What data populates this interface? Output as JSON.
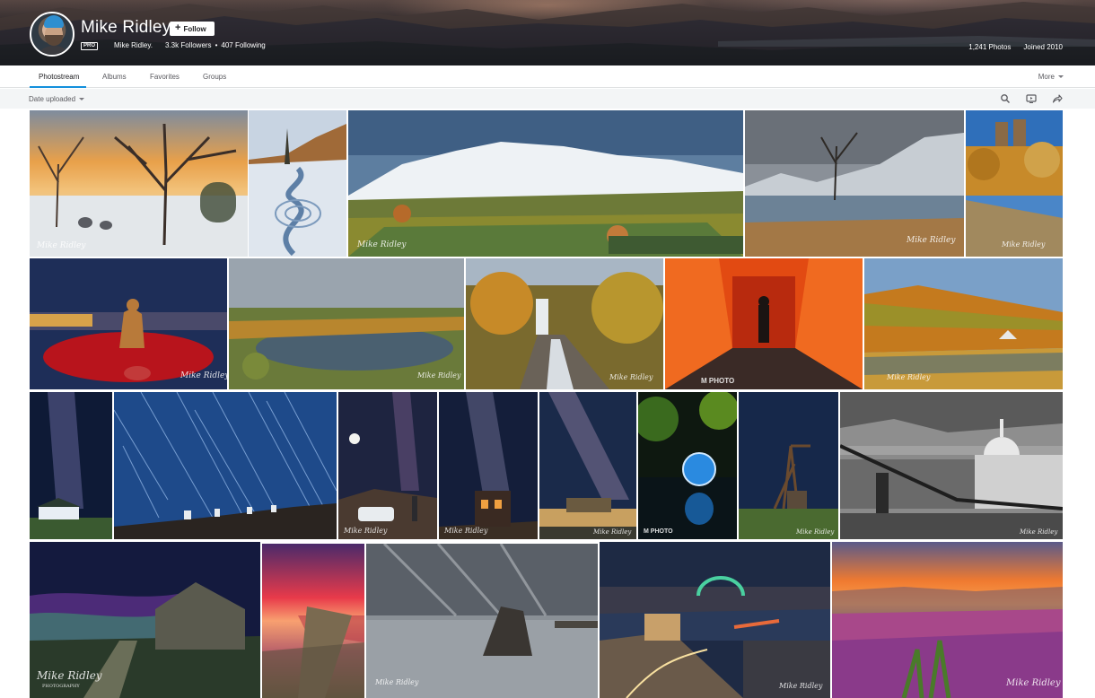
{
  "profile": {
    "name": "Mike Ridley",
    "follow_label": "Follow",
    "pro_label": "PRO",
    "display_name": "Mike Ridley.",
    "followers": "3.3k Followers",
    "following": "407 Following",
    "photos_count": "1,241 Photos",
    "joined": "Joined 2010"
  },
  "tabs": [
    {
      "label": "Photostream",
      "active": true
    },
    {
      "label": "Albums",
      "active": false
    },
    {
      "label": "Favorites",
      "active": false
    },
    {
      "label": "Groups",
      "active": false
    }
  ],
  "more_label": "More",
  "toolbar": {
    "sort_label": "Date uploaded",
    "icons": [
      "search-icon",
      "slideshow-icon",
      "share-icon"
    ]
  },
  "watermarks": {
    "mike_ridley": "Mike Ridley",
    "photography": "PHOTOGRAPHY",
    "m_photo": "M PHOTO"
  },
  "photos": [
    {
      "name": "frosty-tree-sheep",
      "theme": "frost-sunset"
    },
    {
      "name": "frozen-spiral-stream",
      "theme": "frozen-stream"
    },
    {
      "name": "snowy-mountain-valley",
      "theme": "snow-valley"
    },
    {
      "name": "lone-tree-lake",
      "theme": "lone-tree"
    },
    {
      "name": "cathedral-reflection",
      "theme": "cathedral"
    },
    {
      "name": "poppy-soldier-statue",
      "theme": "poppies"
    },
    {
      "name": "tarn-hows-lake",
      "theme": "tarn"
    },
    {
      "name": "high-force-waterfall",
      "theme": "waterfall"
    },
    {
      "name": "fire-tunnel-silhouette",
      "theme": "fire"
    },
    {
      "name": "autumn-river-bandstand",
      "theme": "autumn-river"
    },
    {
      "name": "milky-way-cottage",
      "theme": "milkyway-cottage"
    },
    {
      "name": "star-trails-observatory",
      "theme": "star-trails"
    },
    {
      "name": "moon-car-figure",
      "theme": "moon-car"
    },
    {
      "name": "milky-way-ruin",
      "theme": "milkyway-ruin"
    },
    {
      "name": "milky-way-castle",
      "theme": "milkyway-castle"
    },
    {
      "name": "light-orb-reflection",
      "theme": "light-orb"
    },
    {
      "name": "mine-headframe-night",
      "theme": "headframe"
    },
    {
      "name": "millennium-bridge-st-pauls",
      "theme": "bw-bridge"
    },
    {
      "name": "aurora-chapel",
      "theme": "aurora"
    },
    {
      "name": "jetty-sunset",
      "theme": "jetty"
    },
    {
      "name": "sea-stack-long-exposure",
      "theme": "seastack"
    },
    {
      "name": "tyne-bridge-night",
      "theme": "tyne"
    },
    {
      "name": "heather-sunset-moor",
      "theme": "heather"
    }
  ]
}
